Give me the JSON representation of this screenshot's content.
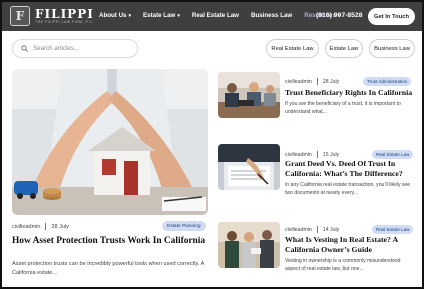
{
  "header": {
    "logo_mark": "F",
    "logo_name": "FILIPPI",
    "logo_sub": "THE FILIPPI LAW FIRM, P.C.",
    "nav": [
      {
        "label": "About Us",
        "dropdown": true,
        "active": false
      },
      {
        "label": "Estate Law",
        "dropdown": true,
        "active": false
      },
      {
        "label": "Real Estate Law",
        "dropdown": false,
        "active": false
      },
      {
        "label": "Business Law",
        "dropdown": false,
        "active": false
      },
      {
        "label": "Resources",
        "dropdown": true,
        "active": true
      }
    ],
    "phone": "(916) 907-8528",
    "cta": "Get In Touch"
  },
  "search": {
    "placeholder": "Search articles..."
  },
  "filters": [
    "Real Estate Law",
    "Estate Law",
    "Business Law"
  ],
  "featured": {
    "author": "civilleadmin",
    "date": "28 July",
    "category": "Estate Planning",
    "title": "How Asset Protection Trusts Work In California",
    "excerpt": "Asset protection trusts can be incredibly powerful tools when used correctly. A California estate..."
  },
  "articles": [
    {
      "author": "civilleadmin",
      "date": "28 July",
      "category": "Trust Administration",
      "title": "Trust Beneficiary Rights In California",
      "excerpt": "If you are the beneficiary of a trust, it is important to understand what..."
    },
    {
      "author": "civilleadmin",
      "date": "15 July",
      "category": "Real Estate Law",
      "title": "Grant Deed Vs. Deed Of Trust In California: What’s The Difference?",
      "excerpt": "In any California real estate transaction, you’ll likely see two documents at nearly every..."
    },
    {
      "author": "civilleadmin",
      "date": "14 July",
      "category": "Real Estate Law",
      "title": "What Is Vesting In Real Estate? A California Owner’s Guide",
      "excerpt": "Vesting in ownership is a commonly misunderstood aspect of real estate law, but one..."
    }
  ],
  "colors": {
    "header_bg": "#3f3f3f",
    "badge_bg": "#cfdcf4",
    "badge_text": "#1e3f80",
    "active_nav": "#b9a3cf"
  }
}
